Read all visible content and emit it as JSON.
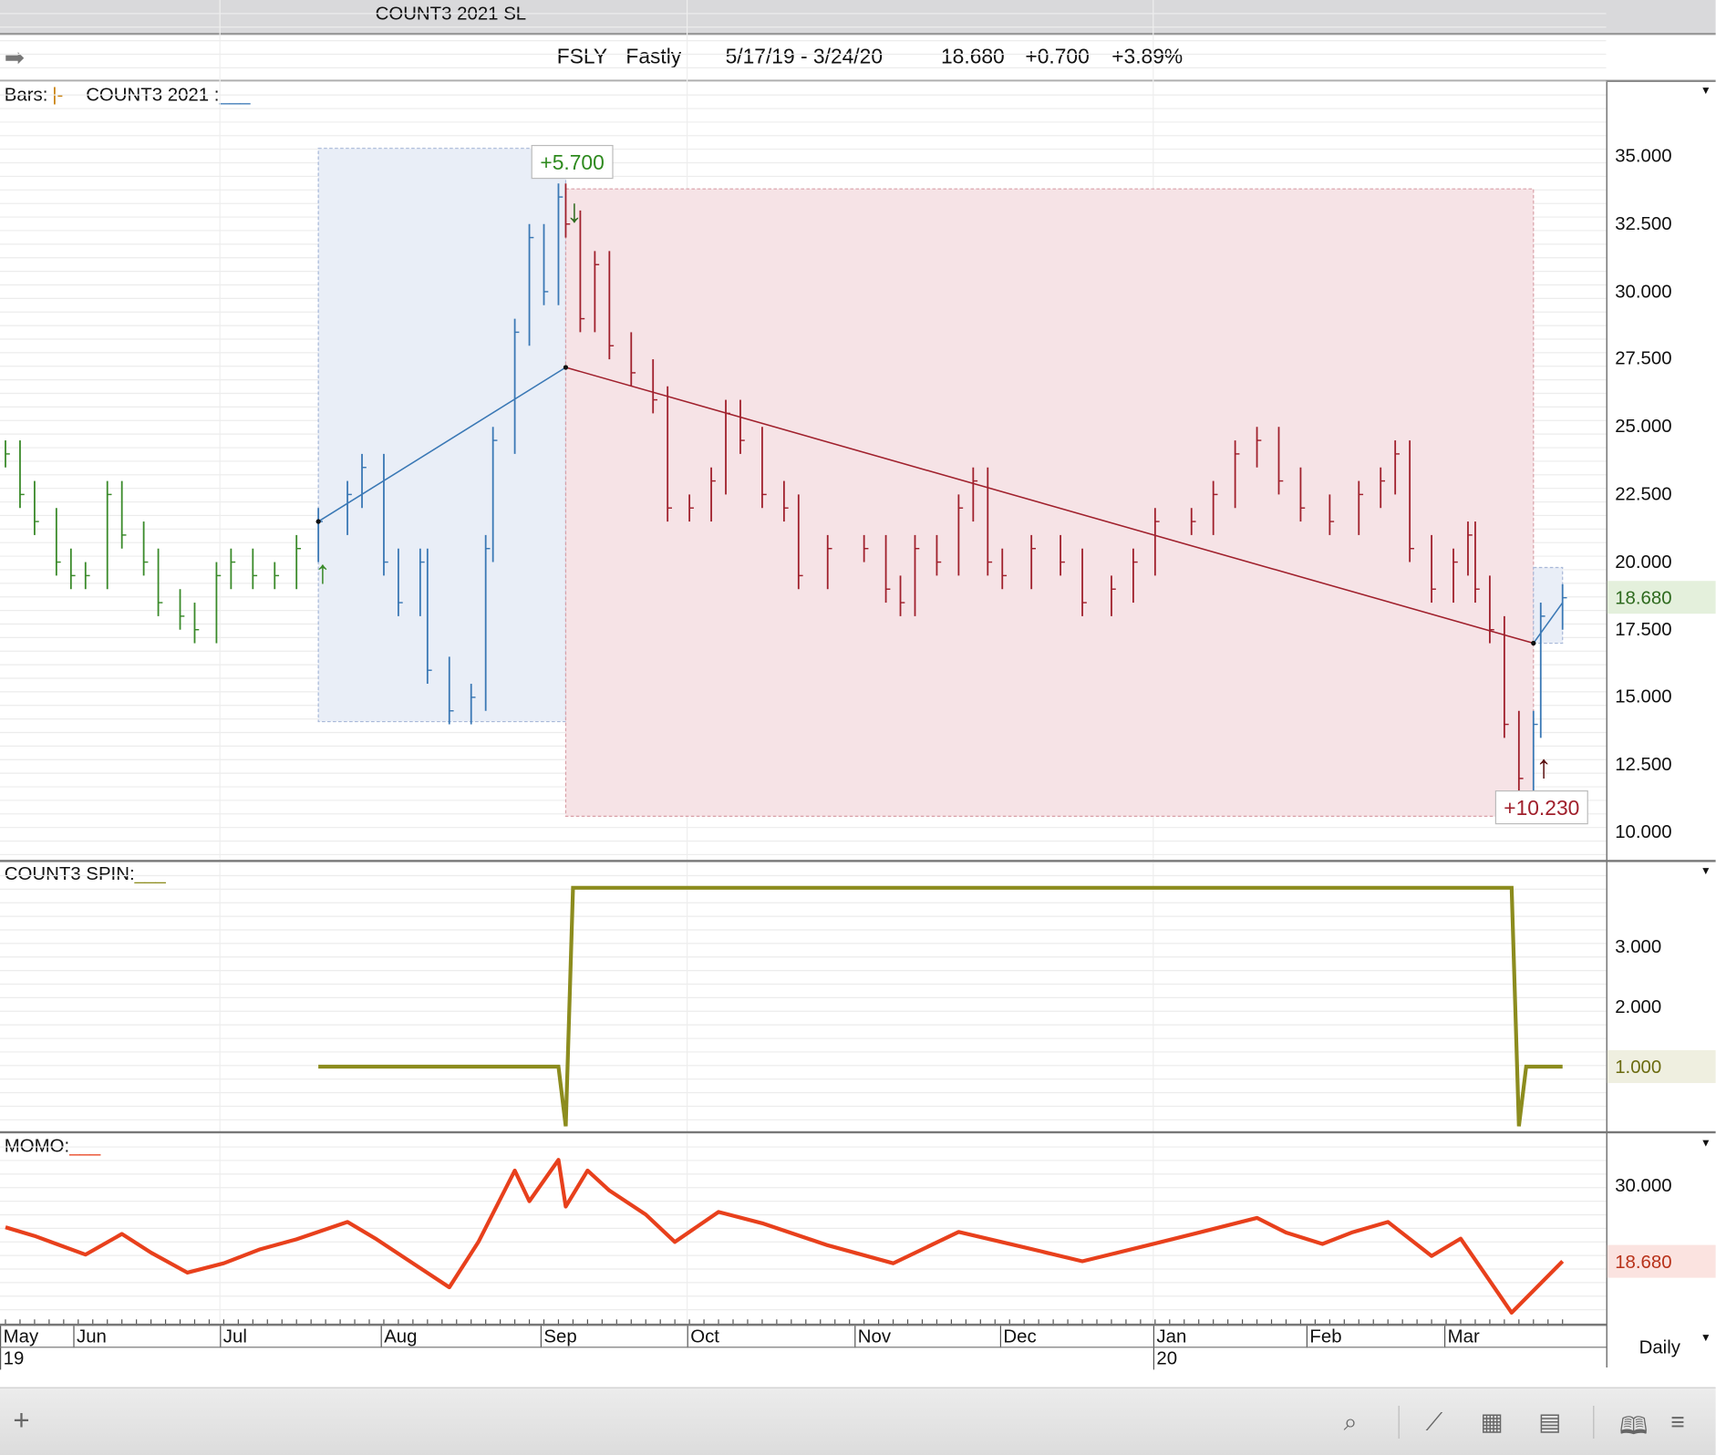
{
  "window_title": "COUNT3 2021 SL",
  "info": {
    "symbol": "FSLY",
    "name": "Fastly",
    "range": "5/17/19 - 3/24/20",
    "last": "18.680",
    "change": "+0.700",
    "pct": "+3.89%"
  },
  "price_panel": {
    "label_bars": "Bars:",
    "bars_style": "|-",
    "label_study": "COUNT3 2021 :",
    "ticks": [
      "35.000",
      "32.500",
      "30.000",
      "27.500",
      "25.000",
      "22.500",
      "20.000",
      "17.500",
      "15.000",
      "12.500",
      "10.000"
    ],
    "current": "18.680",
    "trade1_label": "+5.700",
    "trade2_label": "+10.230",
    "colors": {
      "pre": "#3a8a2a",
      "long": "#3a78b5",
      "short": "#a0202c",
      "box_long": "#e9eef7",
      "box_short": "#f6e3e6"
    }
  },
  "spin_panel": {
    "label": "COUNT3 SPIN:",
    "ticks": [
      "3.000",
      "2.000",
      "1.000"
    ],
    "current": "1.000",
    "color": "#8c8c1e"
  },
  "momo_panel": {
    "label": "MOMO:",
    "ticks": [
      "30.000"
    ],
    "current": "18.680",
    "color": "#e8401c"
  },
  "x_axis": {
    "months": [
      "May",
      "Jun",
      "Jul",
      "Aug",
      "Sep",
      "Oct",
      "Nov",
      "Dec",
      "Jan",
      "Feb",
      "Mar"
    ],
    "years": [
      "19",
      "20"
    ],
    "period": "Daily"
  },
  "chart_data": {
    "type": "bar",
    "x_unit": "trading day index from 5/17/19",
    "price": {
      "days": [
        0,
        2,
        4,
        7,
        9,
        11,
        14,
        16,
        19,
        21,
        24,
        26,
        29,
        31,
        34,
        37,
        40,
        43,
        47,
        49,
        52,
        54,
        57,
        58,
        61,
        64,
        66,
        67,
        70,
        72,
        74,
        76,
        77,
        79,
        81,
        83,
        86,
        89,
        91,
        94,
        97,
        99,
        101,
        104,
        107,
        109,
        113,
        118,
        121,
        123,
        125,
        128,
        131,
        133,
        135,
        137,
        141,
        145,
        148,
        152,
        155,
        158,
        163,
        166,
        169,
        172,
        175,
        178,
        182,
        186,
        189,
        191,
        193,
        196,
        199,
        201,
        202,
        204,
        206,
        208,
        210,
        211,
        214
      ],
      "close": [
        24,
        22.5,
        21.5,
        20,
        19.5,
        19.5,
        22.5,
        21,
        20,
        18.5,
        18,
        17.5,
        19.5,
        20,
        19.5,
        19.5,
        20.5,
        21.5,
        22.5,
        23.5,
        20,
        18.5,
        20,
        16,
        14.5,
        15,
        20.5,
        24.5,
        28.5,
        32,
        30,
        33.5,
        32.5,
        29,
        31,
        28,
        27,
        26,
        22,
        22,
        23,
        25.5,
        24.5,
        22.5,
        22,
        19.5,
        20.5,
        20.5,
        19,
        18.5,
        20.5,
        20,
        22,
        23,
        20,
        19.5,
        20.5,
        20,
        18.5,
        19,
        20,
        21.5,
        21.5,
        22.5,
        24,
        24.5,
        23,
        22,
        21.5,
        22.5,
        23,
        24,
        20.5,
        19,
        20,
        21,
        19,
        17.5,
        14,
        12,
        14,
        18,
        18.68
      ],
      "ylim": [
        10,
        35
      ]
    },
    "trades": [
      {
        "dir": "long",
        "entry_day": 43,
        "exit_day": 77,
        "entry": 21.5,
        "exit": 27.2,
        "box": [
          14.1,
          35.3
        ],
        "profit": "+5.700"
      },
      {
        "dir": "short",
        "entry_day": 77,
        "exit_day": 210,
        "entry": 27.2,
        "exit": 17.0,
        "box": [
          10.6,
          33.8
        ],
        "profit": "+10.230"
      },
      {
        "dir": "long",
        "entry_day": 210,
        "exit_day": 214,
        "entry": 17.0,
        "exit": 18.5,
        "box": [
          17.0,
          19.8
        ]
      }
    ],
    "spin": {
      "points": [
        [
          43,
          1
        ],
        [
          76,
          1
        ],
        [
          77,
          0
        ],
        [
          78,
          4
        ],
        [
          207,
          4
        ],
        [
          208,
          0
        ],
        [
          209,
          1
        ],
        [
          214,
          1
        ]
      ],
      "ylim": [
        0,
        4
      ]
    },
    "momo": {
      "days": [
        0,
        4,
        7,
        11,
        16,
        20,
        25,
        30,
        35,
        40,
        47,
        51,
        56,
        61,
        65,
        70,
        72,
        76,
        77,
        80,
        83,
        88,
        92,
        98,
        104,
        113,
        122,
        131,
        140,
        148,
        157,
        164,
        172,
        176,
        181,
        185,
        190,
        196,
        200,
        207,
        214
      ],
      "values": [
        23.8,
        22.5,
        21.3,
        19.7,
        22.8,
        20.0,
        17.0,
        18.4,
        20.5,
        22.0,
        24.6,
        22.0,
        18.4,
        14.8,
        21.6,
        32.3,
        27.7,
        33.9,
        26.9,
        32.3,
        29.3,
        25.7,
        21.6,
        26.1,
        24.4,
        21.1,
        18.4,
        23.1,
        20.8,
        18.7,
        21.1,
        23.0,
        25.2,
        23.0,
        21.3,
        23.0,
        24.6,
        19.5,
        22.1,
        11.0,
        18.7
      ]
    }
  }
}
